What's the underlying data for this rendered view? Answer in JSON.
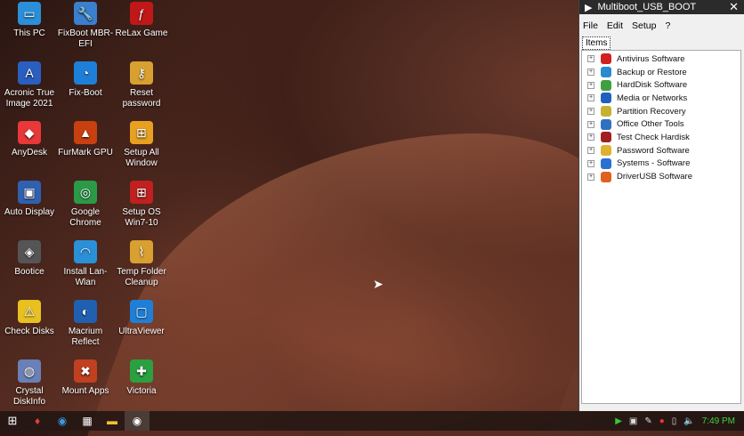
{
  "desktop": {
    "icons": [
      {
        "label": "This PC",
        "icon": "monitor-icon",
        "color": "#2a8fd8"
      },
      {
        "label": "FixBoot MBR-EFI",
        "icon": "wrench-icon",
        "color": "#3a7fd0"
      },
      {
        "label": "ReLax Game",
        "icon": "flash-icon",
        "color": "#c01818"
      },
      {
        "label": "Acronic True Image 2021",
        "icon": "acronis-icon",
        "color": "#2a5fc0"
      },
      {
        "label": "Fix-Boot",
        "icon": "pie-icon",
        "color": "#1e7fd8"
      },
      {
        "label": "Reset password",
        "icon": "key-icon",
        "color": "#d8a030"
      },
      {
        "label": "AnyDesk",
        "icon": "anydesk-icon",
        "color": "#e8383a"
      },
      {
        "label": "FurMark GPU",
        "icon": "furmark-icon",
        "color": "#c84010"
      },
      {
        "label": "Setup All Window",
        "icon": "windows-icon",
        "color": "#e8a020"
      },
      {
        "label": "Auto Display",
        "icon": "display-icon",
        "color": "#3060b0"
      },
      {
        "label": "Google Chrome",
        "icon": "chrome-icon",
        "color": "#2a9a48"
      },
      {
        "label": "Setup OS Win7-10",
        "icon": "windows-icon",
        "color": "#c02020"
      },
      {
        "label": "Bootice",
        "icon": "bootice-icon",
        "color": "#555555"
      },
      {
        "label": "Install Lan-Wlan",
        "icon": "wifi-icon",
        "color": "#2a90d8"
      },
      {
        "label": "Temp Folder Cleanup",
        "icon": "broom-icon",
        "color": "#d8a030"
      },
      {
        "label": "Check Disks",
        "icon": "warning-icon",
        "color": "#e8c020"
      },
      {
        "label": "Macrium Reflect",
        "icon": "macrium-icon",
        "color": "#2060b0"
      },
      {
        "label": "UltraViewer",
        "icon": "ultraviewer-icon",
        "color": "#1e7fd8"
      },
      {
        "label": "Crystal DiskInfo",
        "icon": "disk-icon",
        "color": "#6a80b8"
      },
      {
        "label": "Mount Apps",
        "icon": "tools-icon",
        "color": "#c04020"
      },
      {
        "label": "Victoria",
        "icon": "cross-icon",
        "color": "#2aa040"
      }
    ]
  },
  "window": {
    "title": "Multiboot_USB_BOOT",
    "menu": [
      "File",
      "Edit",
      "Setup",
      "?"
    ],
    "tab": "Items",
    "items": [
      {
        "label": "Antivirus Software",
        "color": "#d02020"
      },
      {
        "label": "Backup or Restore",
        "color": "#2a8ad0"
      },
      {
        "label": "HardDisk Software",
        "color": "#40a040"
      },
      {
        "label": "Media or Networks",
        "color": "#2060c0"
      },
      {
        "label": "Partition Recovery",
        "color": "#c8b030"
      },
      {
        "label": "Office Other Tools",
        "color": "#3070c0"
      },
      {
        "label": "Test Check Hardisk",
        "color": "#a02020"
      },
      {
        "label": "Password Software",
        "color": "#e0b030"
      },
      {
        "label": "Systems - Software",
        "color": "#2a70d0"
      },
      {
        "label": "DriverUSB Software",
        "color": "#e06020"
      }
    ]
  },
  "taskbar": {
    "clock": "7:49 PM"
  }
}
